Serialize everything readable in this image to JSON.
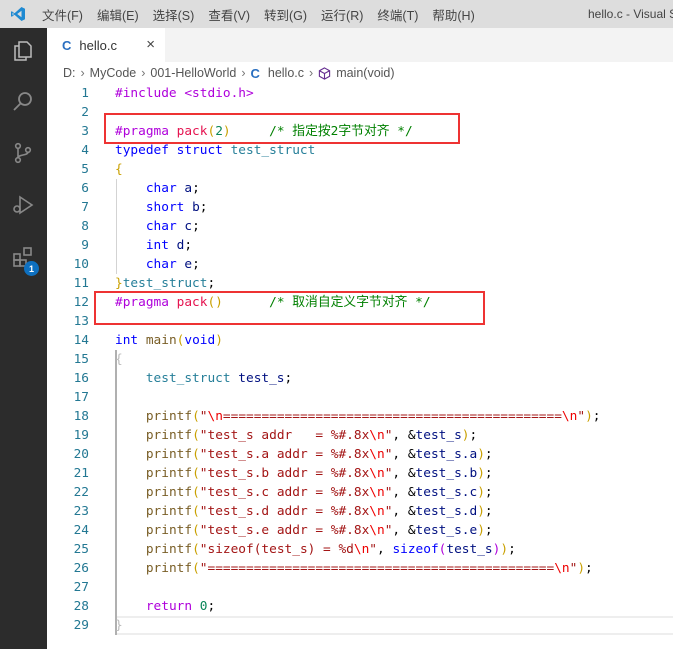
{
  "titlebar": {
    "menus": [
      "文件(F)",
      "编辑(E)",
      "选择(S)",
      "查看(V)",
      "转到(G)",
      "运行(R)",
      "终端(T)",
      "帮助(H)"
    ],
    "window_title": "hello.c - Visual S"
  },
  "activity": {
    "extensions_badge": "1"
  },
  "tab": {
    "icon": "C",
    "label": "hello.c",
    "close": "×"
  },
  "breadcrumb": {
    "items": [
      "D:",
      "MyCode",
      "001-HelloWorld",
      "hello.c",
      "main(void)"
    ],
    "file_icon": "C"
  },
  "code": [
    [
      [
        "pp",
        "#include "
      ],
      [
        "pp",
        "<stdio.h>"
      ]
    ],
    [],
    [
      [
        "pp",
        "#pragma "
      ],
      [
        "mac",
        "pack"
      ],
      [
        "br",
        "("
      ],
      [
        "num",
        "2"
      ],
      [
        "br",
        ")"
      ],
      [
        "p",
        "     "
      ],
      [
        "cm",
        "/* 指定按2字节对齐 */"
      ]
    ],
    [
      [
        "kw",
        "typedef "
      ],
      [
        "kw",
        "struct "
      ],
      [
        "type",
        "test_struct"
      ]
    ],
    [
      [
        "br",
        "{"
      ]
    ],
    [
      [
        "p",
        "    "
      ],
      [
        "kw",
        "char "
      ],
      [
        "var",
        "a"
      ],
      [
        "p",
        ";"
      ]
    ],
    [
      [
        "p",
        "    "
      ],
      [
        "kw",
        "short "
      ],
      [
        "var",
        "b"
      ],
      [
        "p",
        ";"
      ]
    ],
    [
      [
        "p",
        "    "
      ],
      [
        "kw",
        "char "
      ],
      [
        "var",
        "c"
      ],
      [
        "p",
        ";"
      ]
    ],
    [
      [
        "p",
        "    "
      ],
      [
        "kw",
        "int "
      ],
      [
        "var",
        "d"
      ],
      [
        "p",
        ";"
      ]
    ],
    [
      [
        "p",
        "    "
      ],
      [
        "kw",
        "char "
      ],
      [
        "var",
        "e"
      ],
      [
        "p",
        ";"
      ]
    ],
    [
      [
        "br",
        "}"
      ],
      [
        "type",
        "test_struct"
      ],
      [
        "p",
        ";"
      ]
    ],
    [
      [
        "pp",
        "#pragma "
      ],
      [
        "mac",
        "pack"
      ],
      [
        "br",
        "()"
      ],
      [
        "p",
        "      "
      ],
      [
        "cm",
        "/* 取消自定义字节对齐 */"
      ]
    ],
    [],
    [
      [
        "kw",
        "int "
      ],
      [
        "fn",
        "main"
      ],
      [
        "br",
        "("
      ],
      [
        "kw",
        "void"
      ],
      [
        "br",
        ")"
      ]
    ],
    [
      [
        "dim",
        "{"
      ]
    ],
    [
      [
        "p",
        "    "
      ],
      [
        "type",
        "test_struct "
      ],
      [
        "var",
        "test_s"
      ],
      [
        "p",
        ";"
      ]
    ],
    [],
    [
      [
        "p",
        "    "
      ],
      [
        "fn",
        "printf"
      ],
      [
        "br",
        "("
      ],
      [
        "str",
        "\""
      ],
      [
        "esc",
        "\\n"
      ],
      [
        "str",
        "============================================"
      ],
      [
        "esc",
        "\\n"
      ],
      [
        "str",
        "\""
      ],
      [
        "br",
        ")"
      ],
      [
        "p",
        ";"
      ]
    ],
    [
      [
        "p",
        "    "
      ],
      [
        "fn",
        "printf"
      ],
      [
        "br",
        "("
      ],
      [
        "str",
        "\"test_s addr   = %#.8x"
      ],
      [
        "esc",
        "\\n"
      ],
      [
        "str",
        "\""
      ],
      [
        "p",
        ", &"
      ],
      [
        "var",
        "test_s"
      ],
      [
        "br",
        ")"
      ],
      [
        "p",
        ";"
      ]
    ],
    [
      [
        "p",
        "    "
      ],
      [
        "fn",
        "printf"
      ],
      [
        "br",
        "("
      ],
      [
        "str",
        "\"test_s.a addr = %#.8x"
      ],
      [
        "esc",
        "\\n"
      ],
      [
        "str",
        "\""
      ],
      [
        "p",
        ", &"
      ],
      [
        "var",
        "test_s.a"
      ],
      [
        "br",
        ")"
      ],
      [
        "p",
        ";"
      ]
    ],
    [
      [
        "p",
        "    "
      ],
      [
        "fn",
        "printf"
      ],
      [
        "br",
        "("
      ],
      [
        "str",
        "\"test_s.b addr = %#.8x"
      ],
      [
        "esc",
        "\\n"
      ],
      [
        "str",
        "\""
      ],
      [
        "p",
        ", &"
      ],
      [
        "var",
        "test_s.b"
      ],
      [
        "br",
        ")"
      ],
      [
        "p",
        ";"
      ]
    ],
    [
      [
        "p",
        "    "
      ],
      [
        "fn",
        "printf"
      ],
      [
        "br",
        "("
      ],
      [
        "str",
        "\"test_s.c addr = %#.8x"
      ],
      [
        "esc",
        "\\n"
      ],
      [
        "str",
        "\""
      ],
      [
        "p",
        ", &"
      ],
      [
        "var",
        "test_s.c"
      ],
      [
        "br",
        ")"
      ],
      [
        "p",
        ";"
      ]
    ],
    [
      [
        "p",
        "    "
      ],
      [
        "fn",
        "printf"
      ],
      [
        "br",
        "("
      ],
      [
        "str",
        "\"test_s.d addr = %#.8x"
      ],
      [
        "esc",
        "\\n"
      ],
      [
        "str",
        "\""
      ],
      [
        "p",
        ", &"
      ],
      [
        "var",
        "test_s.d"
      ],
      [
        "br",
        ")"
      ],
      [
        "p",
        ";"
      ]
    ],
    [
      [
        "p",
        "    "
      ],
      [
        "fn",
        "printf"
      ],
      [
        "br",
        "("
      ],
      [
        "str",
        "\"test_s.e addr = %#.8x"
      ],
      [
        "esc",
        "\\n"
      ],
      [
        "str",
        "\""
      ],
      [
        "p",
        ", &"
      ],
      [
        "var",
        "test_s.e"
      ],
      [
        "br",
        ")"
      ],
      [
        "p",
        ";"
      ]
    ],
    [
      [
        "p",
        "    "
      ],
      [
        "fn",
        "printf"
      ],
      [
        "br",
        "("
      ],
      [
        "str",
        "\"sizeof(test_s) = %d"
      ],
      [
        "esc",
        "\\n"
      ],
      [
        "str",
        "\""
      ],
      [
        "p",
        ", "
      ],
      [
        "kw",
        "sizeof"
      ],
      [
        "br2",
        "("
      ],
      [
        "var",
        "test_s"
      ],
      [
        "br2",
        ")"
      ],
      [
        "br",
        ")"
      ],
      [
        "p",
        ";"
      ]
    ],
    [
      [
        "p",
        "    "
      ],
      [
        "fn",
        "printf"
      ],
      [
        "br",
        "("
      ],
      [
        "str",
        "\"============================================="
      ],
      [
        "esc",
        "\\n"
      ],
      [
        "str",
        "\""
      ],
      [
        "br",
        ")"
      ],
      [
        "p",
        ";"
      ]
    ],
    [],
    [
      [
        "p",
        "    "
      ],
      [
        "pp",
        "return "
      ],
      [
        "num",
        "0"
      ],
      [
        "p",
        ";"
      ]
    ],
    [
      [
        "dim",
        "}"
      ]
    ]
  ]
}
